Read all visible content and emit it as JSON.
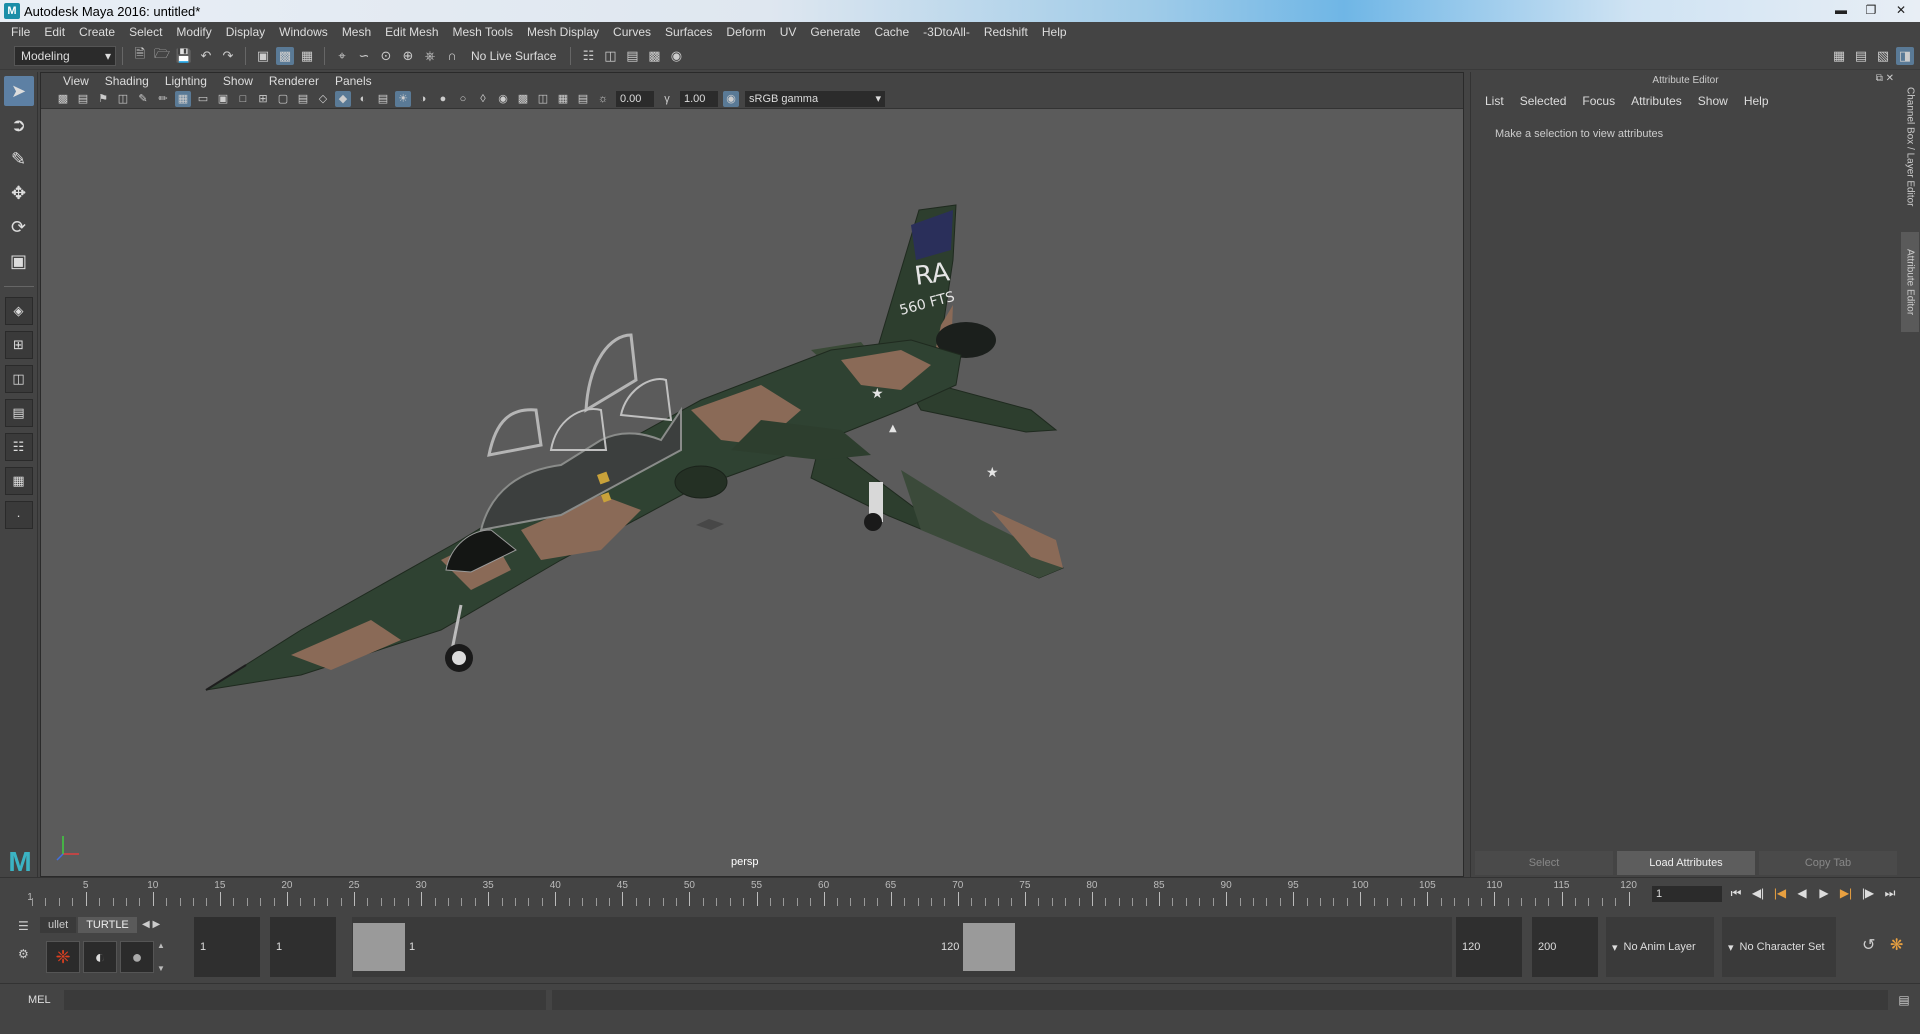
{
  "window": {
    "title": "Autodesk Maya 2016: untitled*",
    "app_icon": "maya-icon",
    "controls": [
      "minimize-icon",
      "restore-icon",
      "close-icon"
    ]
  },
  "menubar": [
    "File",
    "Edit",
    "Create",
    "Select",
    "Modify",
    "Display",
    "Windows",
    "Mesh",
    "Edit Mesh",
    "Mesh Tools",
    "Mesh Display",
    "Curves",
    "Surfaces",
    "Deform",
    "UV",
    "Generate",
    "Cache",
    "-3DtoAll-",
    "Redshift",
    "Help"
  ],
  "statusline": {
    "mode": "Modeling",
    "live_surface": "No Live Surface"
  },
  "viewport": {
    "panel_menu": [
      "View",
      "Shading",
      "Lighting",
      "Show",
      "Renderer",
      "Panels"
    ],
    "exposure": "0.00",
    "gamma": "1.00",
    "color_space": "sRGB gamma",
    "camera_label": "persp"
  },
  "attribute_editor": {
    "title": "Attribute Editor",
    "menu": [
      "List",
      "Selected",
      "Focus",
      "Attributes",
      "Show",
      "Help"
    ],
    "message": "Make a selection to view attributes",
    "buttons": {
      "select": "Select",
      "load": "Load Attributes",
      "copy": "Copy Tab"
    }
  },
  "side_tabs": {
    "channel": "Channel Box / Layer Editor",
    "attr": "Attribute Editor"
  },
  "timeline": {
    "ticks": [
      "5",
      "10",
      "15",
      "20",
      "25",
      "30",
      "35",
      "40",
      "45",
      "50",
      "55",
      "60",
      "65",
      "70",
      "75",
      "80",
      "85",
      "90",
      "95",
      "100",
      "105",
      "110",
      "115",
      "120"
    ],
    "first_label": "1",
    "current_frame": "1"
  },
  "shelf": {
    "tabs": [
      "ullet",
      "TURTLE"
    ]
  },
  "range": {
    "start": "1",
    "playback_start": "1",
    "range_start_label": "1",
    "range_end_label": "120",
    "playback_end": "120",
    "end": "200",
    "anim_layer": "No Anim Layer",
    "char_set": "No Character Set"
  },
  "cmdline": {
    "label": "MEL"
  },
  "colors": {
    "accent": "#5d80a4",
    "viewport_bg": "#5b5b5b",
    "panel_bg": "#444444"
  }
}
